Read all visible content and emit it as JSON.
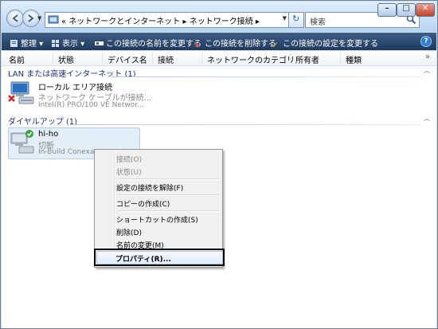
{
  "address": {
    "prefix": "«",
    "crumbs": [
      "ネットワークとインターネット",
      "ネットワーク接続"
    ],
    "separator": "▸"
  },
  "search": {
    "placeholder": "検索"
  },
  "toolbar": {
    "organize": "整理",
    "view": "表示",
    "rename": "この接続の名前を変更する",
    "delete": "この接続を削除する",
    "change_settings": "この接続の設定を変更する",
    "help": "?"
  },
  "columns": [
    "名前",
    "状態",
    "デバイス名",
    "接続",
    "ネットワークのカテゴリ",
    "所有者",
    "種類"
  ],
  "columns_more": "»",
  "groups": [
    {
      "title": "LAN または高速インターネット (1)",
      "items": [
        {
          "name": "ローカル エリア接続",
          "status": "ネットワーク ケーブルが接続...",
          "device": "Intel(R) PRO/100 VE Networ..."
        }
      ]
    },
    {
      "title": "ダイヤルアップ (1)",
      "items": [
        {
          "name": "hi-ho",
          "status": "切断",
          "device": "In-Build Conexant"
        }
      ]
    }
  ],
  "context_menu": {
    "items": [
      {
        "label": "接続(O)",
        "disabled": true
      },
      {
        "label": "状態(U)",
        "disabled": true
      },
      {
        "label": "設定の接続を解除(F)",
        "disabled": false
      },
      {
        "label": "コピーの作成(C)",
        "disabled": false
      },
      {
        "label": "ショートカットの作成(S)",
        "disabled": false
      },
      {
        "label": "削除(D)",
        "disabled": false
      },
      {
        "label": "名前の変更(M)",
        "disabled": false
      },
      {
        "label": "プロパティ(R)...",
        "disabled": false,
        "highlighted": true
      }
    ]
  },
  "colors": {
    "toolbar": "#1d3a5e",
    "group_text": "#1e3287",
    "selection": "#e3eef9"
  }
}
